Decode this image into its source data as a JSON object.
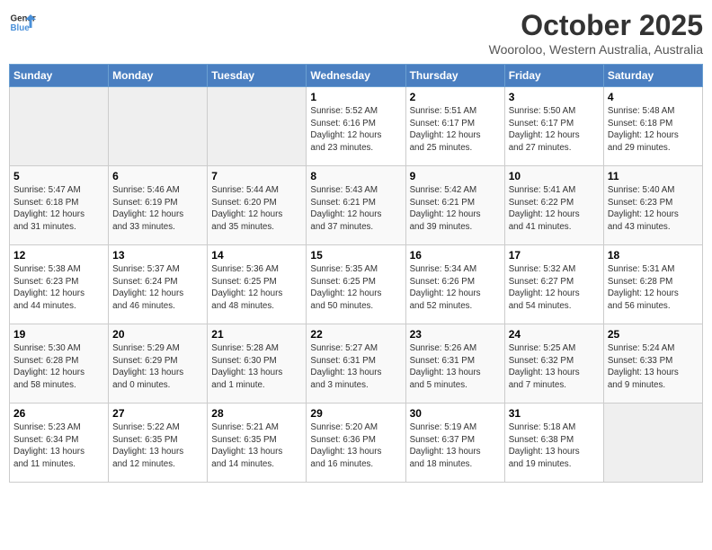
{
  "header": {
    "logo_line1": "General",
    "logo_line2": "Blue",
    "month": "October 2025",
    "location": "Wooroloo, Western Australia, Australia"
  },
  "days_of_week": [
    "Sunday",
    "Monday",
    "Tuesday",
    "Wednesday",
    "Thursday",
    "Friday",
    "Saturday"
  ],
  "weeks": [
    [
      {
        "day": "",
        "info": ""
      },
      {
        "day": "",
        "info": ""
      },
      {
        "day": "",
        "info": ""
      },
      {
        "day": "1",
        "info": "Sunrise: 5:52 AM\nSunset: 6:16 PM\nDaylight: 12 hours\nand 23 minutes."
      },
      {
        "day": "2",
        "info": "Sunrise: 5:51 AM\nSunset: 6:17 PM\nDaylight: 12 hours\nand 25 minutes."
      },
      {
        "day": "3",
        "info": "Sunrise: 5:50 AM\nSunset: 6:17 PM\nDaylight: 12 hours\nand 27 minutes."
      },
      {
        "day": "4",
        "info": "Sunrise: 5:48 AM\nSunset: 6:18 PM\nDaylight: 12 hours\nand 29 minutes."
      }
    ],
    [
      {
        "day": "5",
        "info": "Sunrise: 5:47 AM\nSunset: 6:18 PM\nDaylight: 12 hours\nand 31 minutes."
      },
      {
        "day": "6",
        "info": "Sunrise: 5:46 AM\nSunset: 6:19 PM\nDaylight: 12 hours\nand 33 minutes."
      },
      {
        "day": "7",
        "info": "Sunrise: 5:44 AM\nSunset: 6:20 PM\nDaylight: 12 hours\nand 35 minutes."
      },
      {
        "day": "8",
        "info": "Sunrise: 5:43 AM\nSunset: 6:21 PM\nDaylight: 12 hours\nand 37 minutes."
      },
      {
        "day": "9",
        "info": "Sunrise: 5:42 AM\nSunset: 6:21 PM\nDaylight: 12 hours\nand 39 minutes."
      },
      {
        "day": "10",
        "info": "Sunrise: 5:41 AM\nSunset: 6:22 PM\nDaylight: 12 hours\nand 41 minutes."
      },
      {
        "day": "11",
        "info": "Sunrise: 5:40 AM\nSunset: 6:23 PM\nDaylight: 12 hours\nand 43 minutes."
      }
    ],
    [
      {
        "day": "12",
        "info": "Sunrise: 5:38 AM\nSunset: 6:23 PM\nDaylight: 12 hours\nand 44 minutes."
      },
      {
        "day": "13",
        "info": "Sunrise: 5:37 AM\nSunset: 6:24 PM\nDaylight: 12 hours\nand 46 minutes."
      },
      {
        "day": "14",
        "info": "Sunrise: 5:36 AM\nSunset: 6:25 PM\nDaylight: 12 hours\nand 48 minutes."
      },
      {
        "day": "15",
        "info": "Sunrise: 5:35 AM\nSunset: 6:25 PM\nDaylight: 12 hours\nand 50 minutes."
      },
      {
        "day": "16",
        "info": "Sunrise: 5:34 AM\nSunset: 6:26 PM\nDaylight: 12 hours\nand 52 minutes."
      },
      {
        "day": "17",
        "info": "Sunrise: 5:32 AM\nSunset: 6:27 PM\nDaylight: 12 hours\nand 54 minutes."
      },
      {
        "day": "18",
        "info": "Sunrise: 5:31 AM\nSunset: 6:28 PM\nDaylight: 12 hours\nand 56 minutes."
      }
    ],
    [
      {
        "day": "19",
        "info": "Sunrise: 5:30 AM\nSunset: 6:28 PM\nDaylight: 12 hours\nand 58 minutes."
      },
      {
        "day": "20",
        "info": "Sunrise: 5:29 AM\nSunset: 6:29 PM\nDaylight: 13 hours\nand 0 minutes."
      },
      {
        "day": "21",
        "info": "Sunrise: 5:28 AM\nSunset: 6:30 PM\nDaylight: 13 hours\nand 1 minute."
      },
      {
        "day": "22",
        "info": "Sunrise: 5:27 AM\nSunset: 6:31 PM\nDaylight: 13 hours\nand 3 minutes."
      },
      {
        "day": "23",
        "info": "Sunrise: 5:26 AM\nSunset: 6:31 PM\nDaylight: 13 hours\nand 5 minutes."
      },
      {
        "day": "24",
        "info": "Sunrise: 5:25 AM\nSunset: 6:32 PM\nDaylight: 13 hours\nand 7 minutes."
      },
      {
        "day": "25",
        "info": "Sunrise: 5:24 AM\nSunset: 6:33 PM\nDaylight: 13 hours\nand 9 minutes."
      }
    ],
    [
      {
        "day": "26",
        "info": "Sunrise: 5:23 AM\nSunset: 6:34 PM\nDaylight: 13 hours\nand 11 minutes."
      },
      {
        "day": "27",
        "info": "Sunrise: 5:22 AM\nSunset: 6:35 PM\nDaylight: 13 hours\nand 12 minutes."
      },
      {
        "day": "28",
        "info": "Sunrise: 5:21 AM\nSunset: 6:35 PM\nDaylight: 13 hours\nand 14 minutes."
      },
      {
        "day": "29",
        "info": "Sunrise: 5:20 AM\nSunset: 6:36 PM\nDaylight: 13 hours\nand 16 minutes."
      },
      {
        "day": "30",
        "info": "Sunrise: 5:19 AM\nSunset: 6:37 PM\nDaylight: 13 hours\nand 18 minutes."
      },
      {
        "day": "31",
        "info": "Sunrise: 5:18 AM\nSunset: 6:38 PM\nDaylight: 13 hours\nand 19 minutes."
      },
      {
        "day": "",
        "info": ""
      }
    ]
  ]
}
